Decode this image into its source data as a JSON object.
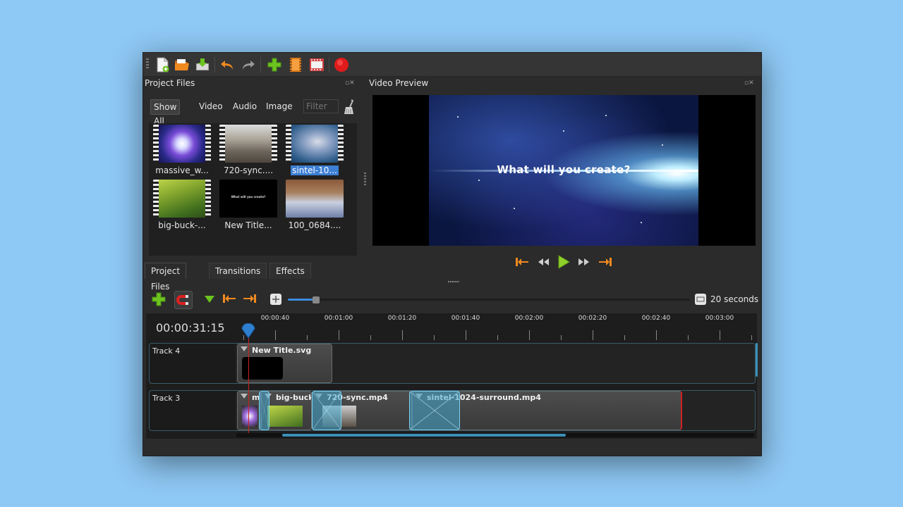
{
  "toolbar": {
    "buttons": [
      {
        "name": "new-project-icon"
      },
      {
        "name": "open-project-icon"
      },
      {
        "name": "save-project-icon"
      },
      {
        "name": "undo-icon"
      },
      {
        "name": "redo-icon"
      },
      {
        "name": "import-files-icon"
      },
      {
        "name": "choose-profile-icon"
      },
      {
        "name": "fullscreen-icon"
      },
      {
        "name": "export-video-icon"
      }
    ]
  },
  "project_files": {
    "title": "Project Files",
    "filters": [
      "Show All",
      "Video",
      "Audio",
      "Image"
    ],
    "filter_placeholder": "Filter",
    "files": [
      {
        "label": "massive_w..."
      },
      {
        "label": "720-sync...."
      },
      {
        "label": "sintel-10...",
        "selected": true
      },
      {
        "label": "big-buck-..."
      },
      {
        "label": "New Title..."
      },
      {
        "label": "100_0684...."
      }
    ],
    "new_title_thumb_text": "What will you create?"
  },
  "bottom_tabs": [
    "Project Files",
    "Transitions",
    "Effects"
  ],
  "video_preview": {
    "title": "Video Preview",
    "overlay_text": "What will you create?"
  },
  "timeline": {
    "zoom_label": "20 seconds",
    "time_readout": "00:00:31:15",
    "ruler_labels": [
      "00:00:40",
      "00:01:00",
      "00:01:20",
      "00:01:40",
      "00:02:00",
      "00:02:20",
      "00:02:40",
      "00:03:00"
    ],
    "tracks": [
      {
        "name": "Track 4",
        "clips": [
          {
            "name": "New Title.svg"
          }
        ]
      },
      {
        "name": "Track 3",
        "clips": [
          {
            "name": "m"
          },
          {
            "name": "big-buck-"
          },
          {
            "name": "720-sync.mp4"
          },
          {
            "name": "sintel-1024-surround.mp4"
          }
        ]
      }
    ]
  },
  "colors": {
    "accent": "#3d7fd4",
    "playhead": "#d02020",
    "add_green": "#6cc31f",
    "nav_orange": "#f08a20",
    "record_red": "#e01b1b"
  }
}
